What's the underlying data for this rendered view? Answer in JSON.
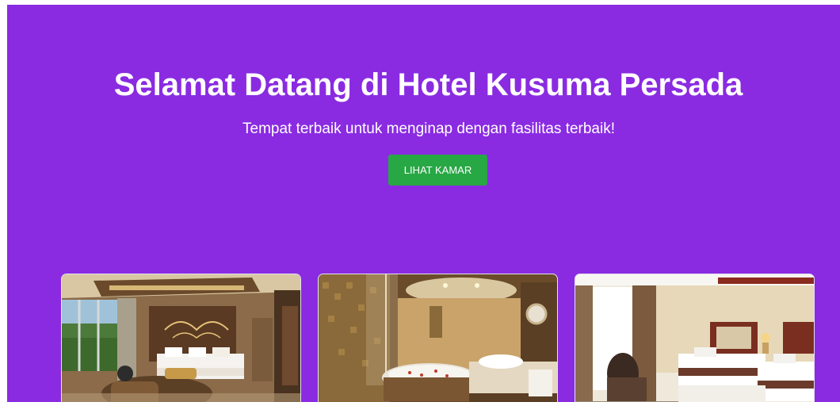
{
  "hero": {
    "title": "Selamat Datang di Hotel Kusuma Persada",
    "subtitle": "Tempat terbaik untuk menginap dengan fasilitas terbaik!",
    "cta_label": "LIHAT KAMAR",
    "background_color": "#8a2be2",
    "cta_color": "#28a745"
  },
  "rooms": [
    {
      "image": "hotel-suite-bedroom-photo"
    },
    {
      "image": "hotel-bathroom-jacuzzi-photo"
    },
    {
      "image": "hotel-twin-bedroom-photo"
    }
  ]
}
